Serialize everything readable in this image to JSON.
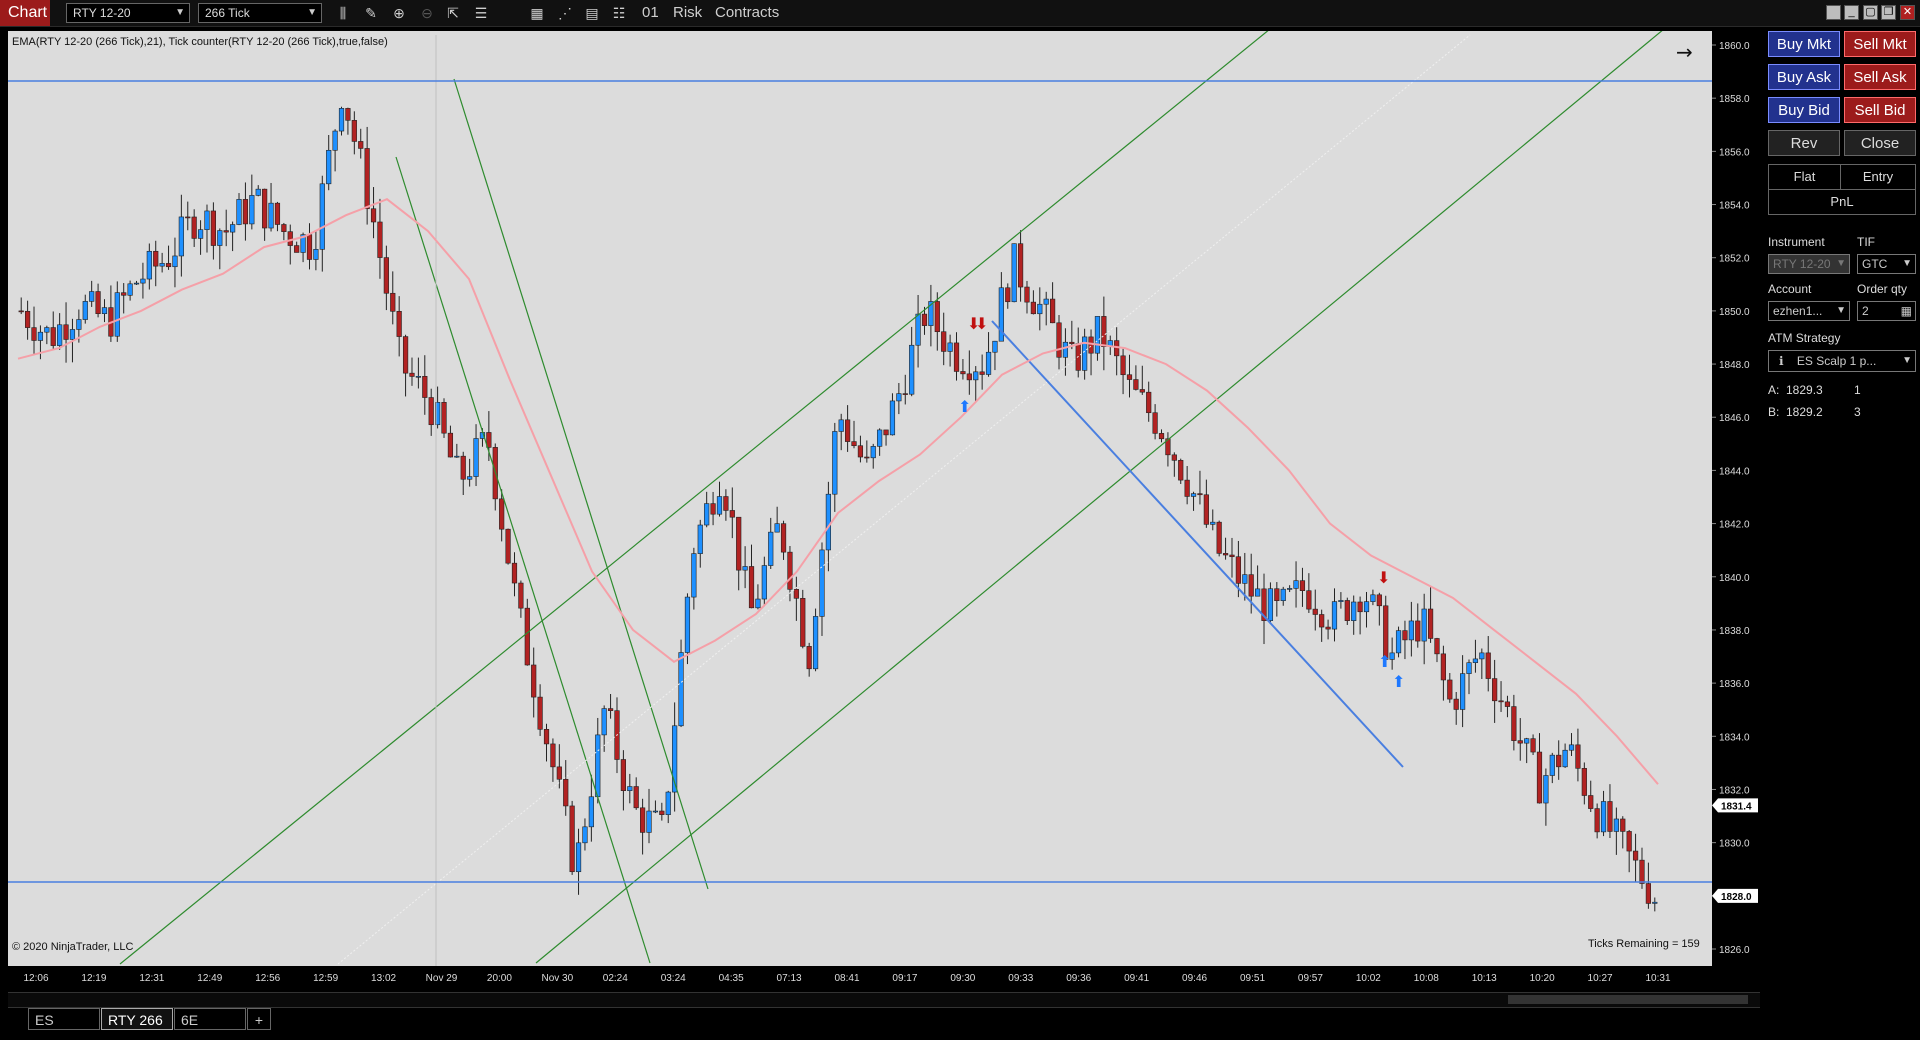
{
  "toolbar": {
    "app_label": "Chart",
    "instrument": "RTY 12-20",
    "interval": "266 Tick",
    "bars_label": "01",
    "risk_label": "Risk",
    "contracts_label": "Contracts"
  },
  "chart": {
    "indicator_label": "EMA(RTY 12-20 (266 Tick),21), Tick counter(RTY 12-20 (266 Tick),true,false)",
    "copyright": "© 2020 NinjaTrader, LLC",
    "ticks_remaining": "Ticks Remaining = 159"
  },
  "chart_data": {
    "type": "candlestick",
    "instrument": "RTY 12-20",
    "interval": "266 Tick",
    "ylim": [
      1825.5,
      1860.5
    ],
    "y_ticks": [
      "1860.0",
      "1858.0",
      "1856.0",
      "1854.0",
      "1852.0",
      "1850.0",
      "1848.0",
      "1846.0",
      "1844.0",
      "1842.0",
      "1840.0",
      "1838.0",
      "1836.0",
      "1834.0",
      "1832.0",
      "1830.0",
      "1828.0",
      "1826.0"
    ],
    "x_ticks": [
      "12:06",
      "12:19",
      "12:31",
      "12:49",
      "12:56",
      "12:59",
      "13:02",
      "Nov 29",
      "20:00",
      "Nov 30",
      "02:24",
      "03:24",
      "04:35",
      "07:13",
      "08:41",
      "09:17",
      "09:30",
      "09:33",
      "09:36",
      "09:41",
      "09:46",
      "09:51",
      "09:57",
      "10:02",
      "10:08",
      "10:13",
      "10:20",
      "10:27",
      "10:31"
    ],
    "close_path": [
      1850.0,
      1849.0,
      1850.2,
      1849.6,
      1851.2,
      1852.0,
      1853.6,
      1853.0,
      1854.2,
      1853.0,
      1852.5,
      1858.4,
      1853.8,
      1848.0,
      1846.6,
      1843.6,
      1845.2,
      1838.8,
      1834.0,
      1829.0,
      1835.0,
      1831.2,
      1830.4,
      1841.0,
      1844.0,
      1838.6,
      1842.0,
      1837.0,
      1846.2,
      1844.0,
      1846.6,
      1850.0,
      1848.4,
      1848.0,
      1851.8,
      1850.0,
      1848.0,
      1849.2,
      1847.0,
      1845.8,
      1843.6,
      1841.0,
      1839.6,
      1838.6,
      1839.6,
      1838.4,
      1839.6,
      1837.0,
      1838.4,
      1835.2,
      1837.2,
      1834.8,
      1832.2,
      1833.6,
      1831.2,
      1829.6,
      1828.0
    ],
    "ema_path": [
      1848.2,
      1848.6,
      1849.4,
      1850.0,
      1850.8,
      1851.4,
      1852.4,
      1852.8,
      1853.6,
      1854.2,
      1853.0,
      1851.2,
      1847.4,
      1843.8,
      1840.2,
      1838.0,
      1836.8,
      1837.6,
      1838.6,
      1840.2,
      1842.4,
      1843.6,
      1844.6,
      1846.0,
      1847.6,
      1848.4,
      1848.8,
      1848.6,
      1848.0,
      1847.0,
      1845.6,
      1844.0,
      1842.0,
      1840.8,
      1840.0,
      1839.2,
      1838.0,
      1836.8,
      1835.6,
      1834.0,
      1832.2
    ],
    "current_price": "1831.4",
    "horizontal_line_price": "1828.0",
    "horizontal_lines": [
      1858.9,
      1828.8
    ]
  },
  "panel": {
    "buy_mkt": "Buy Mkt",
    "sell_mkt": "Sell Mkt",
    "buy_ask": "Buy Ask",
    "sell_ask": "Sell Ask",
    "buy_bid": "Buy Bid",
    "sell_bid": "Sell Bid",
    "rev": "Rev",
    "close": "Close",
    "flat": "Flat",
    "entry": "Entry",
    "pnl": "PnL",
    "instrument_label": "Instrument",
    "tif_label": "TIF",
    "instrument_value": "RTY 12-20",
    "tif_value": "GTC",
    "account_label": "Account",
    "order_qty_label": "Order qty",
    "account_value": "ezhen1...",
    "order_qty_value": "2",
    "atm_label": "ATM Strategy",
    "atm_value": "ES Scalp 1 p...",
    "ask_label": "A:",
    "ask_price": "1829.3",
    "ask_qty": "1",
    "bid_label": "B:",
    "bid_price": "1829.2",
    "bid_qty": "3"
  },
  "tabs": [
    "ES",
    "RTY 266",
    "6E"
  ],
  "colors": {
    "buy": "#22328e",
    "sell": "#9c1b1b",
    "chart_bg": "#dcdcdc",
    "up_candle": "#1e90ff",
    "down_candle": "#b22222"
  }
}
